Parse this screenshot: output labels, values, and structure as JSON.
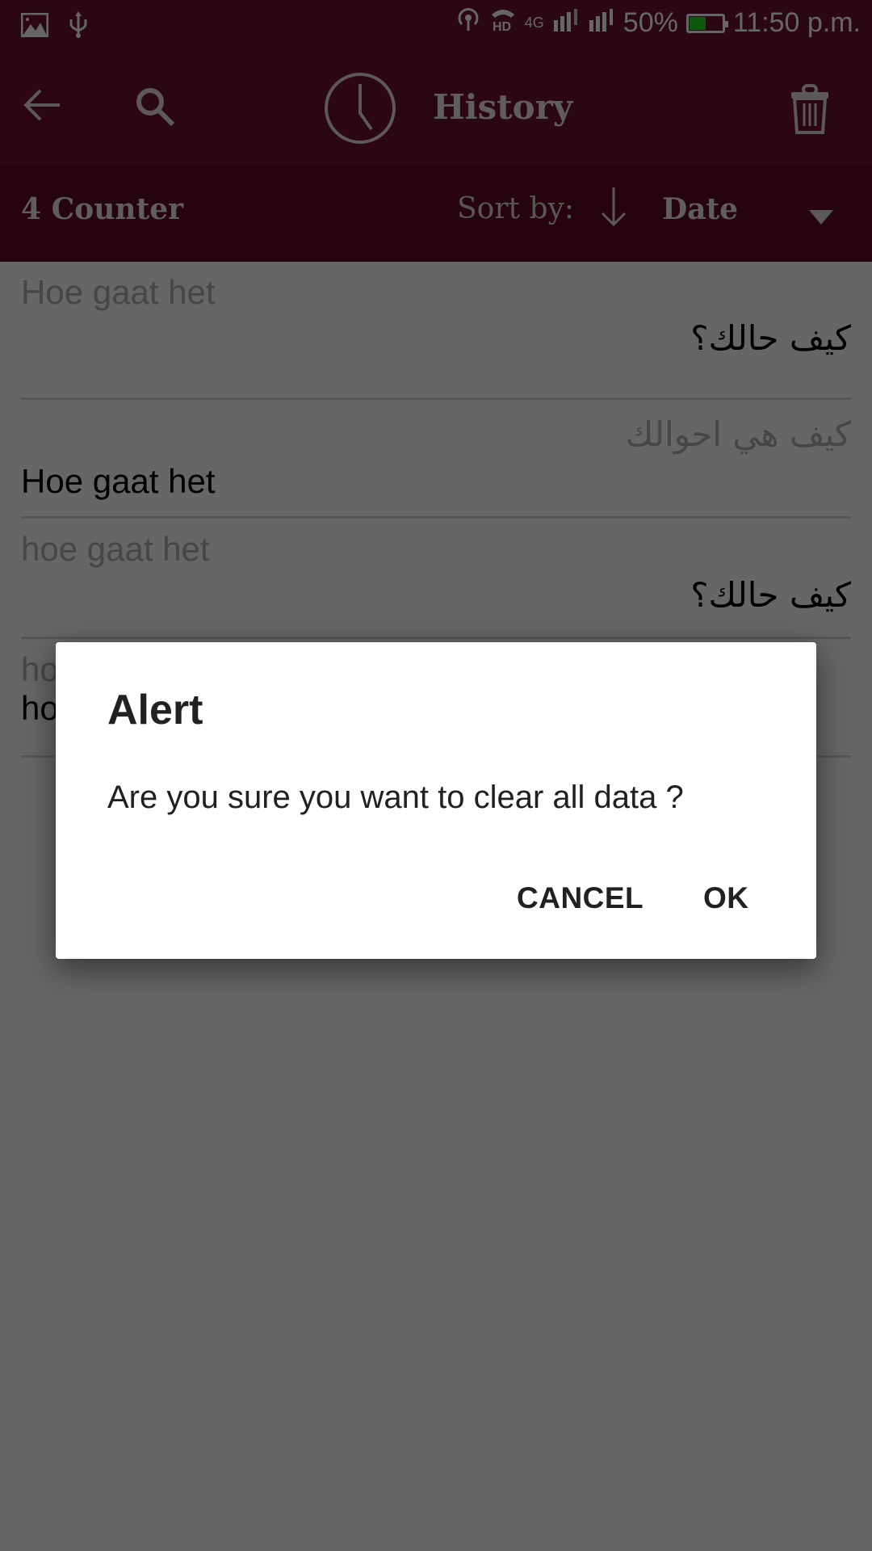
{
  "status_bar": {
    "left_icons": [
      "image-icon",
      "usb-icon"
    ],
    "right_icons": [
      "hotspot-icon",
      "hd-call-icon"
    ],
    "network_label": "4G",
    "battery_percent_text": "50%",
    "battery_level": 0.5,
    "time": "11:50 p.m.",
    "battery_color": "#22dd22"
  },
  "app_bar": {
    "title": "History",
    "back_icon": "arrow-left-icon",
    "search_icon": "search-icon",
    "title_icon": "clock-icon",
    "delete_icon": "trash-icon",
    "color": "#6b1030"
  },
  "sub_bar": {
    "counter": "4 Counter",
    "sort_label": "Sort by:",
    "sort_direction_icon": "arrow-down-icon",
    "sort_value": "Date",
    "dropdown_icon": "triangle-down-icon"
  },
  "history": {
    "items": [
      {
        "source": "Hoe gaat het",
        "source_dir": "ltr",
        "translation": "كيف حالك؟",
        "translation_dir": "rtl"
      },
      {
        "source": "كيف هي احوالك",
        "source_dir": "rtl",
        "translation": "Hoe gaat het",
        "translation_dir": "ltr"
      },
      {
        "source": "hoe gaat het",
        "source_dir": "ltr",
        "translation": "كيف حالك؟",
        "translation_dir": "rtl"
      },
      {
        "source": "ho",
        "source_dir": "ltr",
        "translation": "ho",
        "translation_dir": "ltr"
      }
    ]
  },
  "dialog": {
    "title": "Alert",
    "message": "Are you sure you want to clear all data ?",
    "cancel_label": "CANCEL",
    "ok_label": "OK"
  }
}
